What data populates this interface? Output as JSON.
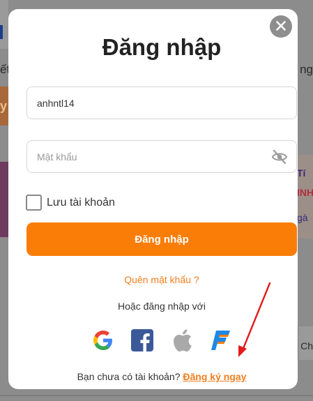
{
  "background": {
    "left_text": "ết",
    "left_badge": "y",
    "right_text": "ng",
    "right_banner_lines": [
      "Tí",
      "INH",
      "gà"
    ],
    "right_box_text": "Ch"
  },
  "modal": {
    "title": "Đăng nhập",
    "username": {
      "value": "anhntl14",
      "placeholder": ""
    },
    "password": {
      "value": "",
      "placeholder": "Mật khẩu"
    },
    "remember_label": "Lưu tài khoản",
    "login_button": "Đăng nhập",
    "forgot_link": "Quên mật khẩu ?",
    "or_text": "Hoặc đăng nhập với",
    "social": [
      {
        "name": "google",
        "icon": "google-icon"
      },
      {
        "name": "facebook",
        "icon": "facebook-icon"
      },
      {
        "name": "apple",
        "icon": "apple-icon"
      },
      {
        "name": "f-brand",
        "icon": "f-brand-icon"
      }
    ],
    "signup_prompt": "Bạn chưa có tài khoản?",
    "signup_link": "Đăng ký ngay"
  },
  "colors": {
    "accent": "#fa7d08",
    "link": "#f07e1e",
    "annotation": "#e21b1b"
  }
}
